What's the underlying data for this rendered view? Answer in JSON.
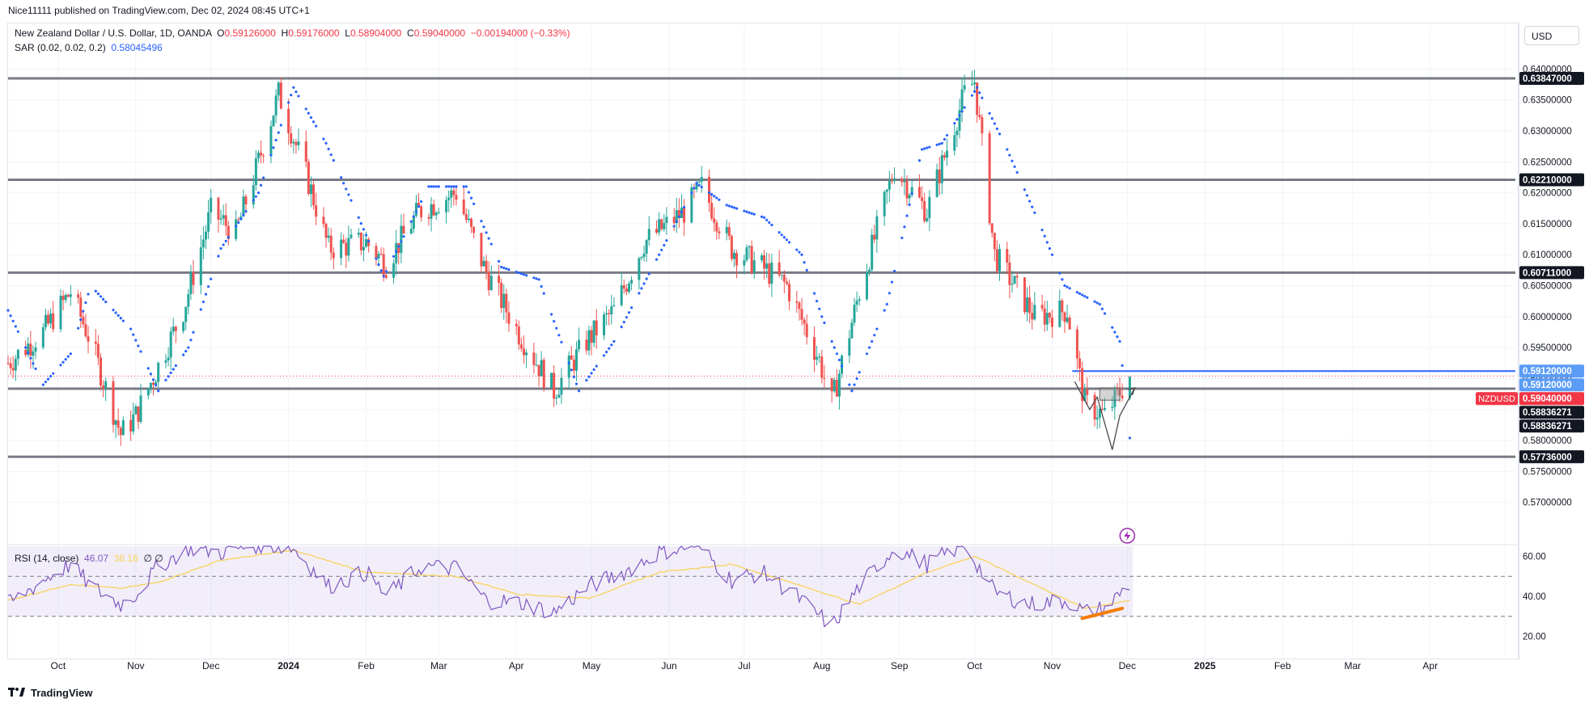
{
  "header": {
    "text": "Nice11111 published on TradingView.com, Dec 02, 2024 08:45 UTC+1"
  },
  "legend": {
    "symbol": "New Zealand Dollar / U.S. Dollar, 1D, OANDA",
    "o_label": "O",
    "o_value": "0.59126000",
    "h_label": "H",
    "h_value": "0.59176000",
    "l_label": "L",
    "l_value": "0.58904000",
    "c_label": "C",
    "c_value": "0.59040000",
    "change": "−0.00194000 (−0.33%)",
    "sar_label": "SAR (0.02, 0.02, 0.2)",
    "sar_value": "0.58045496",
    "rsi_label": "RSI (14, close)",
    "rsi_value": "46.07",
    "rsi_ma_value": "38.16",
    "rsi_extra": "∅ ∅"
  },
  "price_scale": {
    "currency": "USD"
  },
  "footer": {
    "brand": "TradingView"
  },
  "colors": {
    "up": "#26a69a",
    "down": "#ef5350",
    "sar": "#2962ff",
    "rsi": "#7e57c2",
    "rsi_ma": "#f7d25b",
    "level": "#787b86",
    "highlight": "#2962ff",
    "divergence": "#f57c00"
  },
  "chart_data": [
    {
      "type": "candlestick",
      "title": "New Zealand Dollar / U.S. Dollar, 1D, OANDA",
      "ylim": [
        0.565,
        0.642
      ],
      "y_ticks": [
        "0.57000000",
        "0.57500000",
        "0.58000000",
        "0.58500000",
        "0.59000000",
        "0.59500000",
        "0.60000000",
        "0.60500000",
        "0.61000000",
        "0.61500000",
        "0.62000000",
        "0.62500000",
        "0.63000000",
        "0.63500000",
        "0.64000000"
      ],
      "x_ticks": [
        "Oct",
        "Nov",
        "Dec",
        "2024",
        "Feb",
        "Mar",
        "Apr",
        "May",
        "Jun",
        "Jul",
        "Aug",
        "Sep",
        "Oct",
        "Nov",
        "Dec",
        "2025",
        "Feb",
        "Mar",
        "Apr"
      ],
      "x_range": [
        "2023-09-11",
        "2025-05-05"
      ],
      "key_levels": [
        0.63847,
        0.6221,
        0.60711,
        0.58836271,
        0.57736
      ],
      "highlight_level": 0.5912,
      "current_price": 0.5904,
      "price_labels": [
        {
          "text": "0.63847000",
          "value": 0.63847,
          "style": "dark"
        },
        {
          "text": "0.62210000",
          "value": 0.6221,
          "style": "dark"
        },
        {
          "text": "0.60711000",
          "value": 0.60711,
          "style": "dark"
        },
        {
          "text": "0.59120000",
          "value": 0.5912,
          "style": "blue"
        },
        {
          "text": "0.59120000",
          "value": 0.5912,
          "style": "blue"
        },
        {
          "text": "0.59040000",
          "value": 0.5904,
          "style": "red",
          "tag": "NZDUSD"
        },
        {
          "text": "0.58836271",
          "value": 0.58836271,
          "style": "dark"
        },
        {
          "text": "0.58836271",
          "value": 0.58836271,
          "style": "dark"
        },
        {
          "text": "0.57736000",
          "value": 0.57736,
          "style": "dark"
        }
      ],
      "price_path": [
        [
          "2023-09-11",
          0.5925
        ],
        [
          "2023-09-25",
          0.5975
        ],
        [
          "2023-10-06",
          0.604
        ],
        [
          "2023-10-14",
          0.596
        ],
        [
          "2023-10-26",
          0.581
        ],
        [
          "2023-11-01",
          0.584
        ],
        [
          "2023-11-10",
          0.592
        ],
        [
          "2023-11-20",
          0.601
        ],
        [
          "2023-12-01",
          0.617
        ],
        [
          "2023-12-11",
          0.6135
        ],
        [
          "2023-12-20",
          0.625
        ],
        [
          "2023-12-28",
          0.636
        ],
        [
          "2024-01-08",
          0.623
        ],
        [
          "2024-01-17",
          0.611
        ],
        [
          "2024-02-01",
          0.612
        ],
        [
          "2024-02-09",
          0.6085
        ],
        [
          "2024-02-22",
          0.617
        ],
        [
          "2024-03-08",
          0.62
        ],
        [
          "2024-03-19",
          0.608
        ],
        [
          "2024-04-01",
          0.598
        ],
        [
          "2024-04-16",
          0.588
        ],
        [
          "2024-04-29",
          0.596
        ],
        [
          "2024-05-10",
          0.601
        ],
        [
          "2024-05-22",
          0.612
        ],
        [
          "2024-06-07",
          0.617
        ],
        [
          "2024-06-14",
          0.621
        ],
        [
          "2024-06-26",
          0.611
        ],
        [
          "2024-07-08",
          0.608
        ],
        [
          "2024-07-18",
          0.605
        ],
        [
          "2024-07-31",
          0.593
        ],
        [
          "2024-08-05",
          0.586
        ],
        [
          "2024-08-16",
          0.604
        ],
        [
          "2024-08-30",
          0.624
        ],
        [
          "2024-09-12",
          0.617
        ],
        [
          "2024-09-27",
          0.636
        ],
        [
          "2024-10-01",
          0.638
        ],
        [
          "2024-10-09",
          0.61
        ],
        [
          "2024-10-25",
          0.6
        ],
        [
          "2024-11-07",
          0.601
        ],
        [
          "2024-11-14",
          0.586
        ],
        [
          "2024-11-22",
          0.584
        ],
        [
          "2024-12-02",
          0.5904
        ]
      ],
      "sar_path": [
        [
          "2023-09-11",
          0.601
        ],
        [
          "2023-09-25",
          0.589
        ],
        [
          "2023-10-06",
          0.594
        ],
        [
          "2023-10-14",
          0.605
        ],
        [
          "2023-10-30",
          0.598
        ],
        [
          "2023-11-10",
          0.588
        ],
        [
          "2023-11-22",
          0.595
        ],
        [
          "2023-12-05",
          0.611
        ],
        [
          "2023-12-20",
          0.62
        ],
        [
          "2024-01-03",
          0.637
        ],
        [
          "2024-01-16",
          0.628
        ],
        [
          "2024-01-29",
          0.616
        ],
        [
          "2024-02-08",
          0.6065
        ],
        [
          "2024-02-26",
          0.621
        ],
        [
          "2024-03-12",
          0.621
        ],
        [
          "2024-03-26",
          0.608
        ],
        [
          "2024-04-10",
          0.606
        ],
        [
          "2024-04-26",
          0.588
        ],
        [
          "2024-05-10",
          0.596
        ],
        [
          "2024-05-28",
          0.61
        ],
        [
          "2024-06-12",
          0.6215
        ],
        [
          "2024-06-24",
          0.618
        ],
        [
          "2024-07-09",
          0.616
        ],
        [
          "2024-07-24",
          0.61
        ],
        [
          "2024-08-01",
          0.6
        ],
        [
          "2024-08-13",
          0.588
        ],
        [
          "2024-08-27",
          0.602
        ],
        [
          "2024-09-10",
          0.627
        ],
        [
          "2024-09-18",
          0.628
        ],
        [
          "2024-10-02",
          0.637
        ],
        [
          "2024-10-14",
          0.627
        ],
        [
          "2024-10-28",
          0.614
        ],
        [
          "2024-11-06",
          0.605
        ],
        [
          "2024-11-20",
          0.602
        ],
        [
          "2024-11-28",
          0.596
        ],
        [
          "2024-12-02",
          0.5804
        ]
      ],
      "annotations": {
        "zigzag": [
          [
            "2024-11-10",
            0.5895
          ],
          [
            "2024-11-16",
            0.585
          ],
          [
            "2024-11-19",
            0.587
          ],
          [
            "2024-11-25",
            0.5785
          ],
          [
            "2024-11-28",
            0.584
          ],
          [
            "2024-12-04",
            0.5885
          ]
        ],
        "box": {
          "x": [
            "2024-11-20",
            "2024-11-28"
          ],
          "y": [
            0.5865,
            0.5885
          ]
        }
      }
    },
    {
      "type": "line",
      "title": "RSI (14, close)",
      "ylim": [
        15,
        65
      ],
      "y_ticks": [
        "20.00",
        "40.00",
        "60.00"
      ],
      "band": [
        30,
        70
      ],
      "mid": 50,
      "series": [
        {
          "name": "RSI",
          "points": [
            [
              "2023-09-11",
              36
            ],
            [
              "2023-09-25",
              48
            ],
            [
              "2023-10-06",
              56
            ],
            [
              "2023-10-14",
              45
            ],
            [
              "2023-10-26",
              36
            ],
            [
              "2023-11-01",
              41
            ],
            [
              "2023-11-10",
              55
            ],
            [
              "2023-11-22",
              64
            ],
            [
              "2023-12-05",
              62
            ],
            [
              "2023-12-20",
              66
            ],
            [
              "2024-01-03",
              64
            ],
            [
              "2024-01-17",
              45
            ],
            [
              "2024-02-01",
              52
            ],
            [
              "2024-02-09",
              40
            ],
            [
              "2024-02-23",
              55
            ],
            [
              "2024-03-08",
              54
            ],
            [
              "2024-03-20",
              38
            ],
            [
              "2024-04-02",
              37
            ],
            [
              "2024-04-16",
              32
            ],
            [
              "2024-04-30",
              45
            ],
            [
              "2024-05-14",
              52
            ],
            [
              "2024-05-28",
              62
            ],
            [
              "2024-06-12",
              66
            ],
            [
              "2024-06-26",
              48
            ],
            [
              "2024-07-08",
              52
            ],
            [
              "2024-07-22",
              40
            ],
            [
              "2024-08-05",
              25
            ],
            [
              "2024-08-16",
              45
            ],
            [
              "2024-08-30",
              64
            ],
            [
              "2024-09-12",
              56
            ],
            [
              "2024-09-27",
              66
            ],
            [
              "2024-10-09",
              42
            ],
            [
              "2024-10-23",
              36
            ],
            [
              "2024-11-07",
              38
            ],
            [
              "2024-11-14",
              32
            ],
            [
              "2024-11-22",
              34
            ],
            [
              "2024-12-02",
              46
            ]
          ]
        },
        {
          "name": "RSI-based MA",
          "points": [
            [
              "2023-09-11",
              38
            ],
            [
              "2023-10-06",
              46
            ],
            [
              "2023-10-26",
              44
            ],
            [
              "2023-11-10",
              47
            ],
            [
              "2023-12-05",
              58
            ],
            [
              "2024-01-03",
              63
            ],
            [
              "2024-02-01",
              52
            ],
            [
              "2024-03-08",
              50
            ],
            [
              "2024-04-02",
              41
            ],
            [
              "2024-04-30",
              39
            ],
            [
              "2024-05-28",
              52
            ],
            [
              "2024-06-26",
              56
            ],
            [
              "2024-07-22",
              46
            ],
            [
              "2024-08-16",
              36
            ],
            [
              "2024-09-12",
              52
            ],
            [
              "2024-10-01",
              60
            ],
            [
              "2024-10-23",
              47
            ],
            [
              "2024-11-14",
              34
            ],
            [
              "2024-12-02",
              38
            ]
          ]
        }
      ],
      "divergence_line": [
        [
          "2024-11-13",
          29
        ],
        [
          "2024-11-29",
          34
        ]
      ]
    }
  ]
}
